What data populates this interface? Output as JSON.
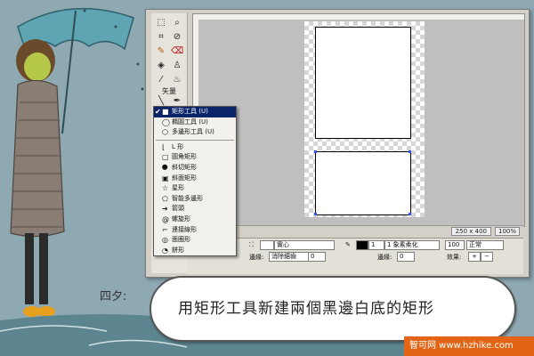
{
  "menu": {
    "items": [
      {
        "label": "矩形工具 (U)",
        "icon": "square",
        "checked": true,
        "active": true
      },
      {
        "label": "橢圓工具 (U)",
        "icon": "circle"
      },
      {
        "label": "多邊形工具 (U)",
        "icon": "polygon"
      }
    ],
    "shapes": [
      {
        "label": "L 形",
        "icon": "l-shape"
      },
      {
        "label": "圓角矩形",
        "icon": "rounded-rect"
      },
      {
        "label": "斜切矩形",
        "icon": "bevel-rect"
      },
      {
        "label": "斜面矩形",
        "icon": "chamfer-rect"
      },
      {
        "label": "星形",
        "icon": "star"
      },
      {
        "label": "智能多邊形",
        "icon": "smart-polygon"
      },
      {
        "label": "箭頭",
        "icon": "arrow"
      },
      {
        "label": "螺旋形",
        "icon": "spiral"
      },
      {
        "label": "連接線形",
        "icon": "connector"
      },
      {
        "label": "面圈形",
        "icon": "doughnut"
      },
      {
        "label": "餅形",
        "icon": "pie"
      }
    ]
  },
  "toolbar": {
    "vector_label": "矢量"
  },
  "status": {
    "size": "250 x 400",
    "zoom": "100%"
  },
  "props": {
    "fill_type": "實心",
    "edge_label": "邊緣:",
    "edge_value": "消除鋸齒",
    "edge_num": "0",
    "stroke_size": "1",
    "stroke_type": "1 象素柔化",
    "edge_label2": "邊緣:",
    "edge_num2": "0",
    "opacity": "100",
    "blend": "正常",
    "effects_label": "效果:"
  },
  "caption": {
    "speaker": "四夕:",
    "text": "用矩形工具新建兩個黑邊白底的矩形"
  },
  "watermark": "智可网 www.hzhike.com"
}
